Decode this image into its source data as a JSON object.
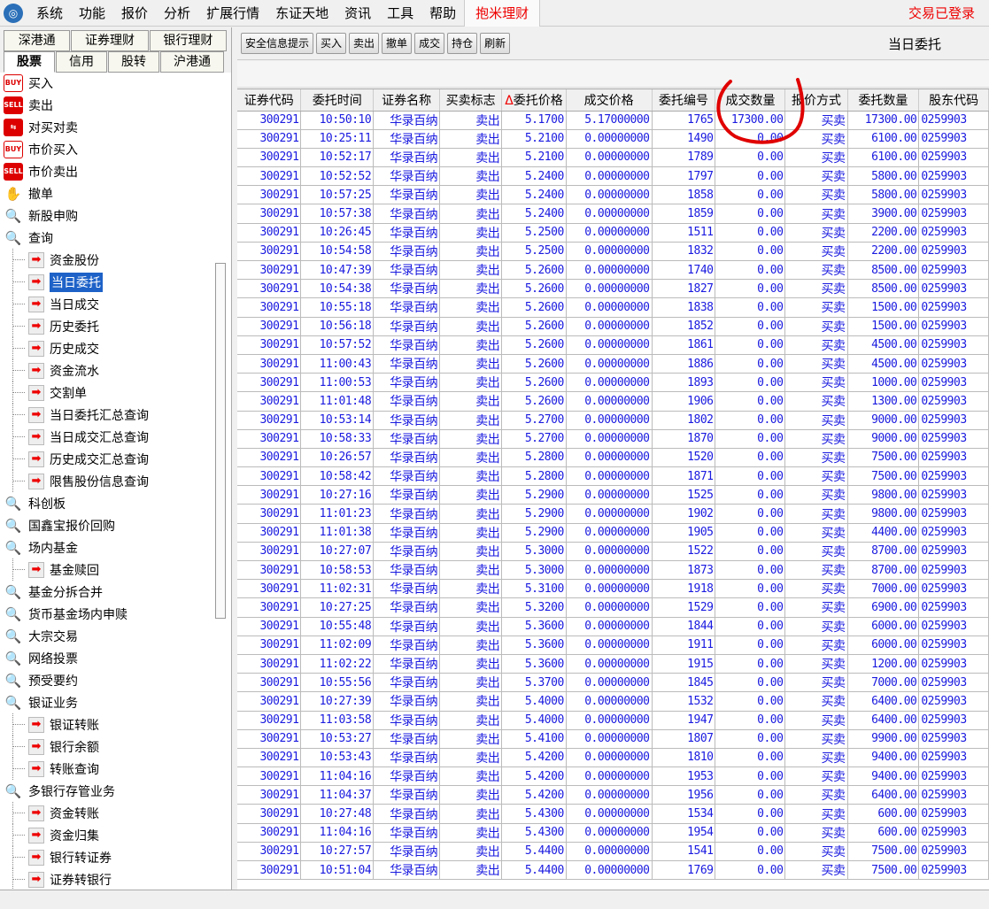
{
  "menu": {
    "items": [
      "系统",
      "功能",
      "报价",
      "分析",
      "扩展行情",
      "东证天地",
      "资讯",
      "工具",
      "帮助"
    ],
    "highlight": "抱米理财",
    "status": "交易已登录"
  },
  "sidebar": {
    "tabs_row1": [
      "深港通",
      "证券理财",
      "银行理财"
    ],
    "tabs_row2": [
      "股票",
      "信用",
      "股转",
      "沪港通"
    ],
    "items": [
      {
        "label": "买入",
        "icon": "buy",
        "sub": false
      },
      {
        "label": "卖出",
        "icon": "sell",
        "sub": false
      },
      {
        "label": "对买对卖",
        "icon": "swap",
        "sub": false
      },
      {
        "label": "市价买入",
        "icon": "buy",
        "sub": false
      },
      {
        "label": "市价卖出",
        "icon": "sell",
        "sub": false
      },
      {
        "label": "撤单",
        "icon": "hand",
        "sub": false
      },
      {
        "label": "新股申购",
        "icon": "mag",
        "sub": false
      },
      {
        "label": "查询",
        "icon": "mag",
        "sub": false
      },
      {
        "label": "资金股份",
        "icon": "arrow",
        "sub": true
      },
      {
        "label": "当日委托",
        "icon": "arrow",
        "sub": true,
        "selected": true
      },
      {
        "label": "当日成交",
        "icon": "arrow",
        "sub": true
      },
      {
        "label": "历史委托",
        "icon": "arrow",
        "sub": true
      },
      {
        "label": "历史成交",
        "icon": "arrow",
        "sub": true
      },
      {
        "label": "资金流水",
        "icon": "arrow",
        "sub": true
      },
      {
        "label": "交割单",
        "icon": "arrow",
        "sub": true
      },
      {
        "label": "当日委托汇总查询",
        "icon": "arrow",
        "sub": true
      },
      {
        "label": "当日成交汇总查询",
        "icon": "arrow",
        "sub": true
      },
      {
        "label": "历史成交汇总查询",
        "icon": "arrow",
        "sub": true
      },
      {
        "label": "限售股份信息查询",
        "icon": "arrow",
        "sub": true
      },
      {
        "label": "科创板",
        "icon": "mag",
        "sub": false
      },
      {
        "label": "国鑫宝报价回购",
        "icon": "mag",
        "sub": false
      },
      {
        "label": "场内基金",
        "icon": "mag",
        "sub": false
      },
      {
        "label": "基金赎回",
        "icon": "arrow",
        "sub": true
      },
      {
        "label": "基金分拆合并",
        "icon": "mag",
        "sub": false
      },
      {
        "label": "货币基金场内申赎",
        "icon": "mag",
        "sub": false
      },
      {
        "label": "大宗交易",
        "icon": "mag",
        "sub": false
      },
      {
        "label": "网络投票",
        "icon": "mag",
        "sub": false
      },
      {
        "label": "预受要约",
        "icon": "mag",
        "sub": false
      },
      {
        "label": "银证业务",
        "icon": "mag",
        "sub": false
      },
      {
        "label": "银证转账",
        "icon": "arrow",
        "sub": true
      },
      {
        "label": "银行余额",
        "icon": "arrow",
        "sub": true
      },
      {
        "label": "转账查询",
        "icon": "arrow",
        "sub": true
      },
      {
        "label": "多银行存管业务",
        "icon": "mag",
        "sub": false
      },
      {
        "label": "资金转账",
        "icon": "arrow",
        "sub": true
      },
      {
        "label": "资金归集",
        "icon": "arrow",
        "sub": true
      },
      {
        "label": "银行转证券",
        "icon": "arrow",
        "sub": true
      },
      {
        "label": "证券转银行",
        "icon": "arrow",
        "sub": true
      }
    ]
  },
  "toolbar": {
    "buttons": [
      "安全信息提示",
      "买入",
      "卖出",
      "撤单",
      "成交",
      "持仓",
      "刷新"
    ],
    "title": "当日委托"
  },
  "table": {
    "columns": [
      "证券代码",
      "委托时间",
      "证券名称",
      "买卖标志",
      "委托价格",
      "成交价格",
      "委托编号",
      "成交数量",
      "报价方式",
      "委托数量",
      "股东代码"
    ],
    "sort_marker": "Δ",
    "code": "300291",
    "name": "华录百纳",
    "flag": "卖出",
    "method": "买卖",
    "holder": "0259903",
    "rows": [
      [
        "10:50:10",
        "5.1700",
        "5.17000000",
        "1765",
        "17300.00",
        "17300.00"
      ],
      [
        "10:25:11",
        "5.2100",
        "0.00000000",
        "1490",
        "0.00",
        "6100.00"
      ],
      [
        "10:52:17",
        "5.2100",
        "0.00000000",
        "1789",
        "0.00",
        "6100.00"
      ],
      [
        "10:52:52",
        "5.2400",
        "0.00000000",
        "1797",
        "0.00",
        "5800.00"
      ],
      [
        "10:57:25",
        "5.2400",
        "0.00000000",
        "1858",
        "0.00",
        "5800.00"
      ],
      [
        "10:57:38",
        "5.2400",
        "0.00000000",
        "1859",
        "0.00",
        "3900.00"
      ],
      [
        "10:26:45",
        "5.2500",
        "0.00000000",
        "1511",
        "0.00",
        "2200.00"
      ],
      [
        "10:54:58",
        "5.2500",
        "0.00000000",
        "1832",
        "0.00",
        "2200.00"
      ],
      [
        "10:47:39",
        "5.2600",
        "0.00000000",
        "1740",
        "0.00",
        "8500.00"
      ],
      [
        "10:54:38",
        "5.2600",
        "0.00000000",
        "1827",
        "0.00",
        "8500.00"
      ],
      [
        "10:55:18",
        "5.2600",
        "0.00000000",
        "1838",
        "0.00",
        "1500.00"
      ],
      [
        "10:56:18",
        "5.2600",
        "0.00000000",
        "1852",
        "0.00",
        "1500.00"
      ],
      [
        "10:57:52",
        "5.2600",
        "0.00000000",
        "1861",
        "0.00",
        "4500.00"
      ],
      [
        "11:00:43",
        "5.2600",
        "0.00000000",
        "1886",
        "0.00",
        "4500.00"
      ],
      [
        "11:00:53",
        "5.2600",
        "0.00000000",
        "1893",
        "0.00",
        "1000.00"
      ],
      [
        "11:01:48",
        "5.2600",
        "0.00000000",
        "1906",
        "0.00",
        "1300.00"
      ],
      [
        "10:53:14",
        "5.2700",
        "0.00000000",
        "1802",
        "0.00",
        "9000.00"
      ],
      [
        "10:58:33",
        "5.2700",
        "0.00000000",
        "1870",
        "0.00",
        "9000.00"
      ],
      [
        "10:26:57",
        "5.2800",
        "0.00000000",
        "1520",
        "0.00",
        "7500.00"
      ],
      [
        "10:58:42",
        "5.2800",
        "0.00000000",
        "1871",
        "0.00",
        "7500.00"
      ],
      [
        "10:27:16",
        "5.2900",
        "0.00000000",
        "1525",
        "0.00",
        "9800.00"
      ],
      [
        "11:01:23",
        "5.2900",
        "0.00000000",
        "1902",
        "0.00",
        "9800.00"
      ],
      [
        "11:01:38",
        "5.2900",
        "0.00000000",
        "1905",
        "0.00",
        "4400.00"
      ],
      [
        "10:27:07",
        "5.3000",
        "0.00000000",
        "1522",
        "0.00",
        "8700.00"
      ],
      [
        "10:58:53",
        "5.3000",
        "0.00000000",
        "1873",
        "0.00",
        "8700.00"
      ],
      [
        "11:02:31",
        "5.3100",
        "0.00000000",
        "1918",
        "0.00",
        "7000.00"
      ],
      [
        "10:27:25",
        "5.3200",
        "0.00000000",
        "1529",
        "0.00",
        "6900.00"
      ],
      [
        "10:55:48",
        "5.3600",
        "0.00000000",
        "1844",
        "0.00",
        "6000.00"
      ],
      [
        "11:02:09",
        "5.3600",
        "0.00000000",
        "1911",
        "0.00",
        "6000.00"
      ],
      [
        "11:02:22",
        "5.3600",
        "0.00000000",
        "1915",
        "0.00",
        "1200.00"
      ],
      [
        "10:55:56",
        "5.3700",
        "0.00000000",
        "1845",
        "0.00",
        "7000.00"
      ],
      [
        "10:27:39",
        "5.4000",
        "0.00000000",
        "1532",
        "0.00",
        "6400.00"
      ],
      [
        "11:03:58",
        "5.4000",
        "0.00000000",
        "1947",
        "0.00",
        "6400.00"
      ],
      [
        "10:53:27",
        "5.4100",
        "0.00000000",
        "1807",
        "0.00",
        "9900.00"
      ],
      [
        "10:53:43",
        "5.4200",
        "0.00000000",
        "1810",
        "0.00",
        "9400.00"
      ],
      [
        "11:04:16",
        "5.4200",
        "0.00000000",
        "1953",
        "0.00",
        "9400.00"
      ],
      [
        "11:04:37",
        "5.4200",
        "0.00000000",
        "1956",
        "0.00",
        "6400.00"
      ],
      [
        "10:27:48",
        "5.4300",
        "0.00000000",
        "1534",
        "0.00",
        "600.00"
      ],
      [
        "11:04:16",
        "5.4300",
        "0.00000000",
        "1954",
        "0.00",
        "600.00"
      ],
      [
        "10:27:57",
        "5.4400",
        "0.00000000",
        "1541",
        "0.00",
        "7500.00"
      ],
      [
        "10:51:04",
        "5.4400",
        "0.00000000",
        "1769",
        "0.00",
        "7500.00"
      ]
    ]
  },
  "colors": {
    "accent": "#1e62c8",
    "cell_text": "#1a1ae0",
    "status": "#ee0000",
    "annotation": "#e00000"
  }
}
